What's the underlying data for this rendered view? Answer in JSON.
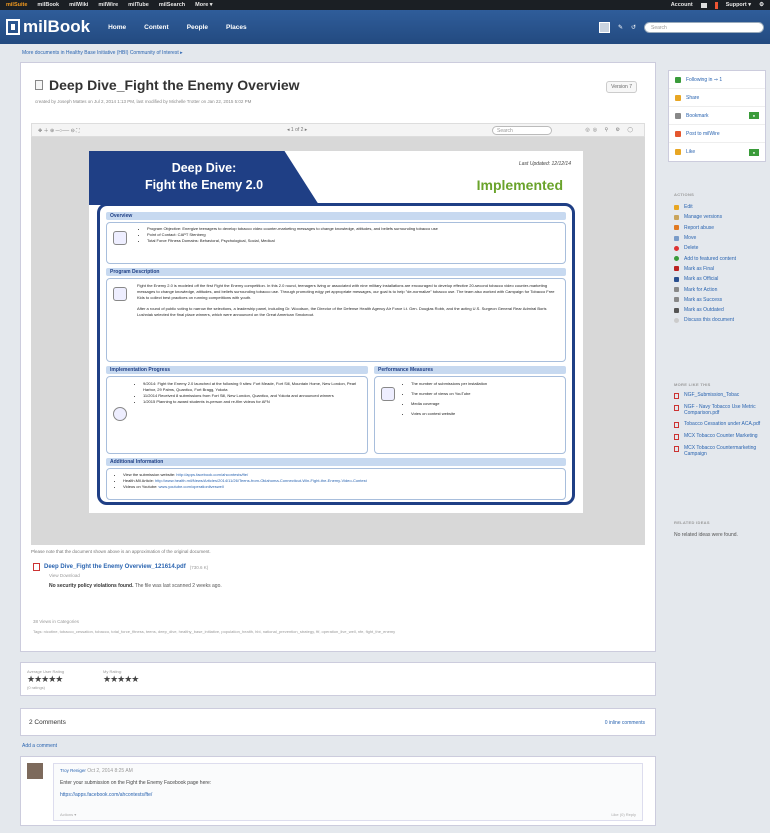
{
  "topbar": {
    "items": [
      "milSuite",
      "milBook",
      "milWiki",
      "milWire",
      "milTube",
      "milSearch",
      "More ▾"
    ],
    "account": "Account",
    "support": "Support ▾"
  },
  "header": {
    "logo": "milBook",
    "nav": [
      "Home",
      "Content",
      "People",
      "Places"
    ],
    "search_placeholder": "Search"
  },
  "breadcrumb": "More documents in  Healthy Base Initiative (HBI) Community of Interest ▸",
  "document": {
    "title": "Deep Dive_Fight the Enemy Overview",
    "subtitle": "created by Joseph Mattes on Jul 2, 2014 1:13 PM, last modified by Michelle Trotter on Jan 22, 2015 5:02 PM",
    "version": "Version 7",
    "viewer": {
      "page_info": "1 of 2",
      "search_placeholder": "Search"
    },
    "slide": {
      "title_line1": "Deep Dive:",
      "title_line2": "Fight the Enemy 2.0",
      "updated": "Last Updated: 12/12/14",
      "status": "Implemented",
      "overview_heading": "Overview",
      "overview_items": [
        "Program Objective: Energize teenagers to develop tobacco video counter-marketing messages to change knowledge, attitudes, and beliefs surrounding tobacco use",
        "Point of Contact: CAPT Stenberg",
        "Total Force Fitness Domains: Behavioral, Psychological, Social, Medical"
      ],
      "description_heading": "Program Description",
      "description_p1": "Fight the Enemy 2.0 is modeled off the first Fight the Enemy competition. In this 2.0 round, teenagers living or associated with nine military installations are encouraged to develop effective 20-second tobacco video counter-marketing messages to change knowledge, attitudes, and beliefs surrounding tobacco use. Through promoting edgy yet appropriate messages, our goal is to help \"de-normalize\" tobacco use. The team also worked with Campaign for Tobacco Free Kids to collect best practices on running competitions with youth.",
      "description_p2": "After a round of public voting to narrow the selections, a leadership panel, including Dr. Woodson, the Director of the Defense Health Agency Air Force Lt. Gen. Douglas Robb, and the acting U.S. Surgeon General Rear Admiral Boris Lushniak selected the final place winners, which were announced on the Great American Smokeout.",
      "implementation_heading": "Implementation Progress",
      "implementation_items": [
        "9/2014: Fight the Enemy 2.0 launched at the following 9 sites: Fort Meade, Fort Sill, Mountain Home, New London, Pearl Harbor, 29 Palms, Quantico, Fort Bragg, Yokota",
        "11/2014 Received 8 submissions from Fort Sill, New London, Quantico, and Yokota and announced winners",
        "1/2015 Planning to award students in-person and re-film videos for AFN"
      ],
      "performance_heading": "Performance Measures",
      "performance_items": [
        "The number of submissions per installation",
        "The number of views on YouTube",
        "Media coverage",
        "Votes on contest website"
      ],
      "additional_heading": "Additional Information",
      "additional_items": [
        {
          "label": "View the submission website: ",
          "link": "http://apps.facebook.com/ahcontests/fte/"
        },
        {
          "label": "Health.Mil Article: ",
          "link": "http://www.health.mil/News/Articles/2014/11/26/Teens-from-Oklahoma-Connecticut-Win-Fight-the-Enemy-Video-Contest"
        },
        {
          "label": "Videos on Youtube: ",
          "link": "www.youtube.com/operationliveswell"
        }
      ]
    },
    "viewer_note": "Please note that the document shown above is an approximation of the original document.",
    "attachment": {
      "name": "Deep Dive_Fight the Enemy Overview_121614.pdf",
      "size": "(730.6 K)",
      "view_download": "View  Download"
    },
    "security_bold": "No security policy violations found.",
    "security_rest": " The file was last scanned 2 weeks ago.",
    "views": "38 Views    in  Categories",
    "tags": "Tags: nicotine, tobacco_cessation, tobacco, total_force_fitness, teens, deep_dive, healthy_base_initiative, population_health, hbi, national_prevention_strategy, ftf, operation_live_well, nfe, fight_the_enemy"
  },
  "rating": {
    "average_label": "Average User Rating",
    "average_sub": "(0 ratings)",
    "my_label": "My Rating:",
    "stars": "★★★★★"
  },
  "comments": {
    "count": "2 Comments",
    "inline": "0 inline comments",
    "add": "Add a comment",
    "item": {
      "author": "Troy Reniger",
      "time": "Oct 2, 2014 8:25 AM",
      "text": "Enter your submission on the Fight the Enemy Facebook page here:",
      "link": "https://apps.facebook.com/ahcontests/fte/",
      "actions": "Actions ▾",
      "like": "Like (0)    Reply"
    }
  },
  "sidebar": {
    "following": "Following in",
    "share": "Share",
    "bookmark": "Bookmark",
    "post_to_milwire": "Post to milWire",
    "like": "Like",
    "actions_heading": "ACTIONS",
    "actions": [
      "Edit",
      "Manage versions",
      "Report abuse",
      "Move",
      "Delete",
      "Add to featured content",
      "Mark as Final",
      "Mark as Official",
      "Mark for Action",
      "Mark as Success",
      "Mark as Outdated",
      "Discuss this document"
    ],
    "more_heading": "MORE LIKE THIS",
    "more": [
      "NGF_Submission_Tobac",
      "NGF - Navy Tobacco Use Metric Comparison.pdf",
      "Tobacco Cessation under ACA.pdf",
      "MCX Tobacco Counter Marketing",
      "MCX Tobacco Countermarketing Campaign"
    ],
    "related_heading": "RELATED IDEAS",
    "related_none": "No related ideas were found."
  },
  "colors": {
    "header_blue": "#2f5d9a",
    "slide_navy": "#1f3f85",
    "implemented_green": "#6aa32b",
    "link_blue": "#2a64b0"
  }
}
